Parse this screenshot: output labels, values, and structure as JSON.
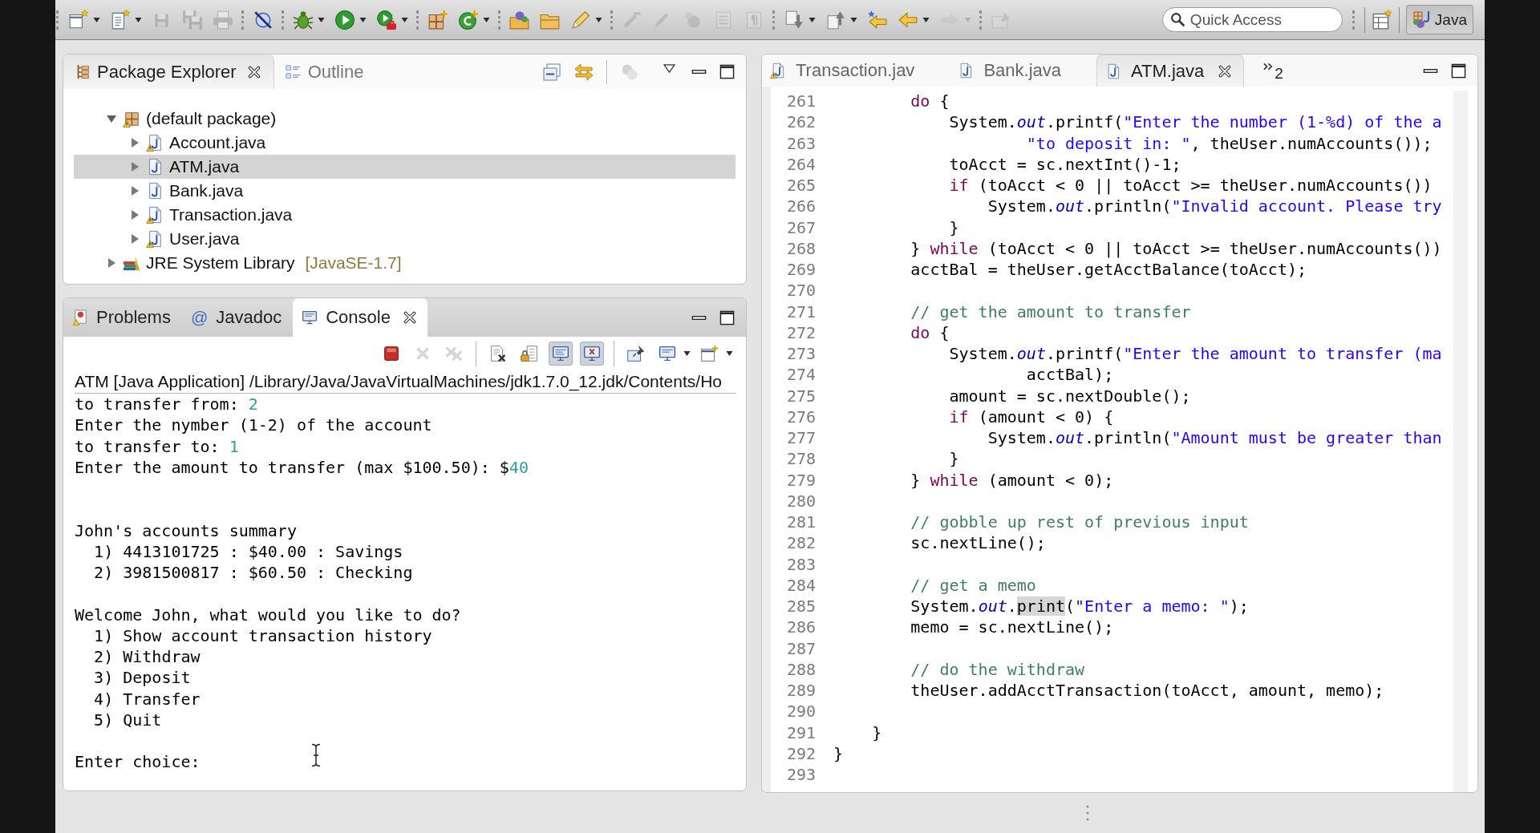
{
  "toolbar": {
    "groups": [
      {
        "items": [
          {
            "kind": "new",
            "disabled": false,
            "dropdown": true
          },
          {
            "kind": "newlist",
            "disabled": false,
            "dropdown": true
          },
          {
            "kind": "save",
            "disabled": true,
            "dropdown": false
          },
          {
            "kind": "saveall",
            "disabled": true,
            "dropdown": false
          },
          {
            "kind": "print",
            "disabled": true,
            "dropdown": false
          }
        ]
      },
      {
        "items": [
          {
            "kind": "skip",
            "disabled": false,
            "dropdown": false
          }
        ]
      },
      {
        "items": [
          {
            "kind": "debug",
            "disabled": false,
            "dropdown": true
          },
          {
            "kind": "run",
            "disabled": false,
            "dropdown": true
          },
          {
            "kind": "external",
            "disabled": false,
            "dropdown": true
          }
        ]
      },
      {
        "items": [
          {
            "kind": "package",
            "disabled": false,
            "dropdown": false
          },
          {
            "kind": "class",
            "disabled": false,
            "dropdown": true
          }
        ]
      },
      {
        "items": [
          {
            "kind": "opentype",
            "disabled": false,
            "dropdown": false
          },
          {
            "kind": "opentask",
            "disabled": false,
            "dropdown": false
          },
          {
            "kind": "search",
            "disabled": false,
            "dropdown": true
          }
        ]
      },
      {
        "items": [
          {
            "kind": "marker",
            "disabled": true,
            "dropdown": false
          },
          {
            "kind": "pen",
            "disabled": true,
            "dropdown": false
          },
          {
            "kind": "blob",
            "disabled": true,
            "dropdown": false
          },
          {
            "kind": "block",
            "disabled": true,
            "dropdown": false
          },
          {
            "kind": "pilcrow",
            "disabled": true,
            "dropdown": false
          }
        ]
      },
      {
        "items": [
          {
            "kind": "nextannotation",
            "disabled": false,
            "dropdown": true
          },
          {
            "kind": "prevannotation",
            "disabled": false,
            "dropdown": true
          },
          {
            "kind": "lastedit",
            "disabled": false,
            "dropdown": false
          },
          {
            "kind": "back",
            "disabled": false,
            "dropdown": true
          },
          {
            "kind": "forward",
            "disabled": true,
            "dropdown": true
          }
        ]
      },
      {
        "items": [
          {
            "kind": "pin",
            "disabled": true,
            "dropdown": false
          }
        ]
      }
    ],
    "quick_access": {
      "placeholder": "Quick Access"
    },
    "perspectives": [
      {
        "label": "Java",
        "selected": true
      }
    ]
  },
  "package_explorer": {
    "tabs": [
      {
        "label": "Package Explorer",
        "selected": true
      },
      {
        "label": "Outline",
        "selected": false
      }
    ],
    "tree": [
      {
        "label": "(default package)",
        "kind": "package",
        "warning": true,
        "expanded": true,
        "selected": false,
        "children": [
          {
            "label": "Account.java",
            "kind": "file",
            "warning": true,
            "expanded": false,
            "selected": false
          },
          {
            "label": "ATM.java",
            "kind": "file",
            "warning": false,
            "expanded": false,
            "selected": true
          },
          {
            "label": "Bank.java",
            "kind": "file",
            "warning": false,
            "expanded": false,
            "selected": false
          },
          {
            "label": "Transaction.java",
            "kind": "file",
            "warning": true,
            "expanded": false,
            "selected": false
          },
          {
            "label": "User.java",
            "kind": "file",
            "warning": true,
            "expanded": false,
            "selected": false
          }
        ]
      },
      {
        "label": "JRE System Library",
        "decoration": "[JavaSE-1.7]",
        "kind": "library",
        "warning": false,
        "expanded": false,
        "selected": false
      }
    ]
  },
  "bottom_panel": {
    "tabs": [
      {
        "label": "Problems",
        "selected": false
      },
      {
        "label": "Javadoc",
        "glyph": "@",
        "selected": false
      },
      {
        "label": "Console",
        "selected": true
      }
    ],
    "toolbar": [
      {
        "items": [
          {
            "kind": "terminate",
            "disabled": false,
            "pressed": false,
            "dropdown": false
          },
          {
            "kind": "remove",
            "disabled": true,
            "pressed": false,
            "dropdown": false
          },
          {
            "kind": "removeall",
            "disabled": true,
            "pressed": false,
            "dropdown": false
          }
        ]
      },
      {
        "items": [
          {
            "kind": "clear",
            "disabled": false,
            "pressed": false,
            "dropdown": false
          },
          {
            "kind": "scrolllock",
            "disabled": false,
            "pressed": false,
            "dropdown": false
          },
          {
            "kind": "stdout",
            "disabled": false,
            "pressed": true,
            "dropdown": false
          },
          {
            "kind": "stderr",
            "disabled": false,
            "pressed": true,
            "dropdown": false
          }
        ]
      },
      {
        "items": [
          {
            "kind": "pin",
            "disabled": false,
            "pressed": false,
            "dropdown": false
          },
          {
            "kind": "display",
            "disabled": false,
            "pressed": false,
            "dropdown": true
          },
          {
            "kind": "open",
            "disabled": false,
            "pressed": false,
            "dropdown": true
          }
        ]
      }
    ],
    "process_label": "ATM [Java Application] /Library/Java/JavaVirtualMachines/jdk1.7.0_12.jdk/Contents/Ho",
    "output": [
      {
        "kind": "text",
        "text": "to transfer from: ",
        "input": "2"
      },
      {
        "kind": "text",
        "text": "Enter the nymber (1-2) of the account"
      },
      {
        "kind": "text",
        "text": "to transfer to: ",
        "input": "1"
      },
      {
        "kind": "text",
        "text": "Enter the amount to transfer (max $100.50): $",
        "input": "40"
      },
      {
        "kind": "blank"
      },
      {
        "kind": "blank"
      },
      {
        "kind": "text",
        "text": "John's accounts summary"
      },
      {
        "kind": "text",
        "text": "  1) 4413101725 : $40.00 : Savings"
      },
      {
        "kind": "text",
        "text": "  2) 3981500817 : $60.50 : Checking"
      },
      {
        "kind": "blank"
      },
      {
        "kind": "text",
        "text": "Welcome John, what would you like to do?"
      },
      {
        "kind": "text",
        "text": "  1) Show account transaction history"
      },
      {
        "kind": "text",
        "text": "  2) Withdraw"
      },
      {
        "kind": "text",
        "text": "  3) Deposit"
      },
      {
        "kind": "text",
        "text": "  4) Transfer"
      },
      {
        "kind": "text",
        "text": "  5) Quit"
      },
      {
        "kind": "blank"
      },
      {
        "kind": "text",
        "text": "Enter choice: "
      }
    ]
  },
  "editor": {
    "tabs": [
      {
        "label": "Transaction.jav",
        "warning": true,
        "selected": false
      },
      {
        "label": "Bank.java",
        "warning": false,
        "selected": false
      },
      {
        "label": "ATM.java",
        "warning": false,
        "selected": true
      }
    ],
    "overflow_count": "2",
    "lines": [
      {
        "number": "261",
        "tokens": [
          {
            "kind": "keyword",
            "text": "\t\tdo"
          },
          {
            "kind": "plain",
            "text": " {"
          }
        ]
      },
      {
        "number": "262",
        "tokens": [
          {
            "kind": "plain",
            "text": "\t\t\tSystem."
          },
          {
            "kind": "field",
            "text": "out"
          },
          {
            "kind": "plain",
            "text": ".printf("
          },
          {
            "kind": "string",
            "text": "\"Enter the number (1-%d) of the a"
          }
        ]
      },
      {
        "number": "263",
        "tokens": [
          {
            "kind": "string",
            "text": "\t\t\t\t\t\"to deposit in: \""
          },
          {
            "kind": "plain",
            "text": ", theUser.numAccounts());"
          }
        ]
      },
      {
        "number": "264",
        "tokens": [
          {
            "kind": "plain",
            "text": "\t\t\ttoAcct = sc.nextInt()-1;"
          }
        ]
      },
      {
        "number": "265",
        "tokens": [
          {
            "kind": "keyword",
            "text": "\t\t\tif"
          },
          {
            "kind": "plain",
            "text": " (toAcct < 0 || toAcct >= theUser.numAccounts())"
          }
        ]
      },
      {
        "number": "266",
        "tokens": [
          {
            "kind": "plain",
            "text": "\t\t\t\tSystem."
          },
          {
            "kind": "field",
            "text": "out"
          },
          {
            "kind": "plain",
            "text": ".println("
          },
          {
            "kind": "string",
            "text": "\"Invalid account. Please try"
          }
        ]
      },
      {
        "number": "267",
        "tokens": [
          {
            "kind": "plain",
            "text": "\t\t\t}"
          }
        ]
      },
      {
        "number": "268",
        "tokens": [
          {
            "kind": "plain",
            "text": "\t\t} "
          },
          {
            "kind": "keyword",
            "text": "while"
          },
          {
            "kind": "plain",
            "text": " (toAcct < 0 || toAcct >= theUser.numAccounts())"
          }
        ]
      },
      {
        "number": "269",
        "tokens": [
          {
            "kind": "plain",
            "text": "\t\tacctBal = theUser.getAcctBalance(toAcct);"
          }
        ]
      },
      {
        "number": "270"
      },
      {
        "number": "271",
        "tokens": [
          {
            "kind": "comment",
            "text": "\t\t// get the amount to transfer"
          }
        ]
      },
      {
        "number": "272",
        "tokens": [
          {
            "kind": "keyword",
            "text": "\t\tdo"
          },
          {
            "kind": "plain",
            "text": " {"
          }
        ]
      },
      {
        "number": "273",
        "tokens": [
          {
            "kind": "plain",
            "text": "\t\t\tSystem."
          },
          {
            "kind": "field",
            "text": "out"
          },
          {
            "kind": "plain",
            "text": ".printf("
          },
          {
            "kind": "string",
            "text": "\"Enter the amount to transfer (ma"
          }
        ]
      },
      {
        "number": "274",
        "tokens": [
          {
            "kind": "plain",
            "text": "\t\t\t\t\tacctBal);"
          }
        ]
      },
      {
        "number": "275",
        "tokens": [
          {
            "kind": "plain",
            "text": "\t\t\tamount = sc.nextDouble();"
          }
        ]
      },
      {
        "number": "276",
        "tokens": [
          {
            "kind": "keyword",
            "text": "\t\t\tif"
          },
          {
            "kind": "plain",
            "text": " (amount < 0) {"
          }
        ]
      },
      {
        "number": "277",
        "tokens": [
          {
            "kind": "plain",
            "text": "\t\t\t\tSystem."
          },
          {
            "kind": "field",
            "text": "out"
          },
          {
            "kind": "plain",
            "text": ".println("
          },
          {
            "kind": "string",
            "text": "\"Amount must be greater than"
          }
        ]
      },
      {
        "number": "278",
        "tokens": [
          {
            "kind": "plain",
            "text": "\t\t\t}"
          }
        ]
      },
      {
        "number": "279",
        "tokens": [
          {
            "kind": "plain",
            "text": "\t\t} "
          },
          {
            "kind": "keyword",
            "text": "while"
          },
          {
            "kind": "plain",
            "text": " (amount < 0);"
          }
        ]
      },
      {
        "number": "280"
      },
      {
        "number": "281",
        "tokens": [
          {
            "kind": "comment",
            "text": "\t\t// gobble up rest of previous input"
          }
        ]
      },
      {
        "number": "282",
        "tokens": [
          {
            "kind": "plain",
            "text": "\t\tsc.nextLine();"
          }
        ]
      },
      {
        "number": "283"
      },
      {
        "number": "284",
        "tokens": [
          {
            "kind": "comment",
            "text": "\t\t// get a memo"
          }
        ]
      },
      {
        "number": "285",
        "tokens": [
          {
            "kind": "plain",
            "text": "\t\tSystem."
          },
          {
            "kind": "field",
            "text": "out"
          },
          {
            "kind": "plain",
            "text": "."
          },
          {
            "kind": "occurrence",
            "text": "print"
          },
          {
            "kind": "plain",
            "text": "("
          },
          {
            "kind": "string",
            "text": "\"Enter a memo: \""
          },
          {
            "kind": "plain",
            "text": ");"
          }
        ]
      },
      {
        "number": "286",
        "tokens": [
          {
            "kind": "plain",
            "text": "\t\tmemo = sc.nextLine();"
          }
        ]
      },
      {
        "number": "287"
      },
      {
        "number": "288",
        "tokens": [
          {
            "kind": "comment",
            "text": "\t\t// do the withdraw"
          }
        ]
      },
      {
        "number": "289",
        "tokens": [
          {
            "kind": "plain",
            "text": "\t\ttheUser.addAcctTransaction(toAcct, amount, memo);"
          }
        ]
      },
      {
        "number": "290"
      },
      {
        "number": "291",
        "tokens": [
          {
            "kind": "plain",
            "text": "\t}"
          }
        ]
      },
      {
        "number": "292",
        "tokens": [
          {
            "kind": "plain",
            "text": "}"
          }
        ]
      },
      {
        "number": "293"
      }
    ]
  }
}
